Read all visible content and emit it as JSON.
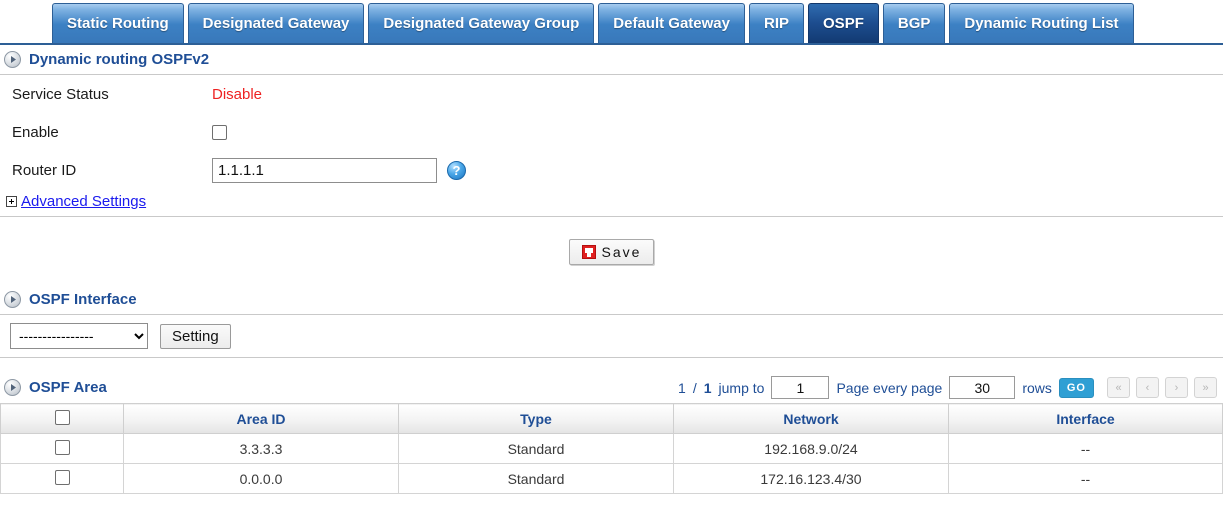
{
  "tabs": [
    {
      "label": "Static Routing",
      "active": false
    },
    {
      "label": "Designated Gateway",
      "active": false
    },
    {
      "label": "Designated Gateway Group",
      "active": false
    },
    {
      "label": "Default Gateway",
      "active": false
    },
    {
      "label": "RIP",
      "active": false
    },
    {
      "label": "OSPF",
      "active": true
    },
    {
      "label": "BGP",
      "active": false
    },
    {
      "label": "Dynamic Routing List",
      "active": false
    }
  ],
  "ospfv2": {
    "title": "Dynamic routing OSPFv2",
    "service_status_label": "Service Status",
    "service_status_value": "Disable",
    "service_status_color": "#ee2222",
    "enable_label": "Enable",
    "enable_checked": false,
    "router_id_label": "Router ID",
    "router_id_value": "1.1.1.1",
    "help_icon_text": "?",
    "advanced_settings_label": "Advanced Settings"
  },
  "save": {
    "label": "Save",
    "icon": "floppy-disk-icon"
  },
  "interface": {
    "title": "OSPF Interface",
    "select_value": "----------------",
    "setting_label": "Setting"
  },
  "area": {
    "title": "OSPF Area",
    "pager": {
      "current_page": "1",
      "separator": "/",
      "total_pages": "1",
      "jump_to_label": "jump to",
      "jump_to_value": "1",
      "page_every_page_label": "Page every page",
      "rows_value": "30",
      "rows_label": "rows",
      "go_label": "GO",
      "first_icon": "«",
      "prev_icon": "‹",
      "next_icon": "›",
      "last_icon": "»"
    },
    "columns": [
      "",
      "Area ID",
      "Type",
      "Network",
      "Interface"
    ],
    "rows": [
      {
        "checked": false,
        "area_id": "3.3.3.3",
        "type": "Standard",
        "network": "192.168.9.0/24",
        "interface": "--"
      },
      {
        "checked": false,
        "area_id": "0.0.0.0",
        "type": "Standard",
        "network": "172.16.123.4/30",
        "interface": "--"
      }
    ]
  },
  "colors": {
    "tab_active": "#123a72",
    "tab_normal": "#3d81c4",
    "header_blue": "#1f4e96",
    "link_blue": "#1a1aee",
    "go_blue": "#2f9fd4",
    "danger_red": "#ee2222"
  }
}
